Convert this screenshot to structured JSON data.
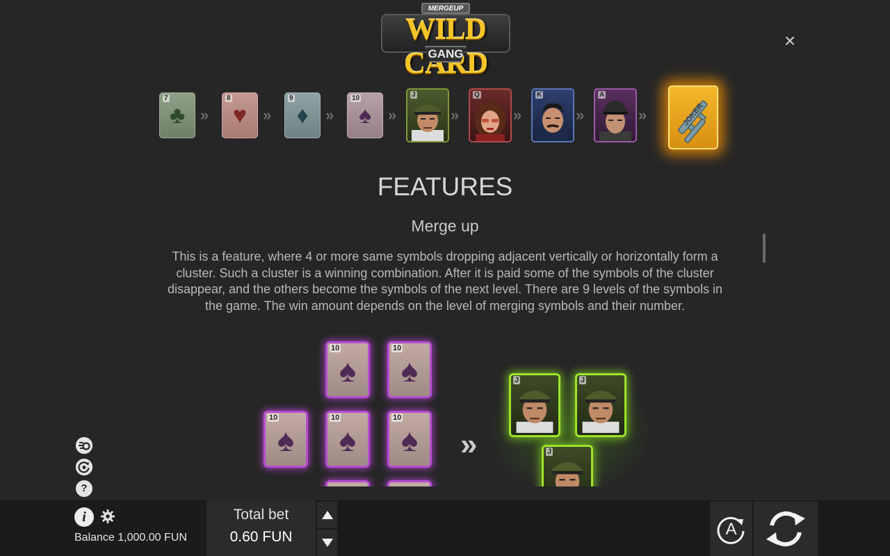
{
  "logo": {
    "brand": "MERGEUP",
    "title": "WILD CARD",
    "subtitle": "GANG"
  },
  "close_icon": "×",
  "levels": [
    {
      "rank": "7",
      "suit": "♣",
      "kind": "club-card"
    },
    {
      "rank": "8",
      "suit": "♥",
      "kind": "heart-card"
    },
    {
      "rank": "9",
      "suit": "♦",
      "kind": "diamond-card"
    },
    {
      "rank": "10",
      "suit": "♠",
      "kind": "spade-card"
    },
    {
      "rank": "J",
      "kind": "jack-portrait"
    },
    {
      "rank": "Q",
      "kind": "queen-portrait"
    },
    {
      "rank": "K",
      "kind": "king-portrait"
    },
    {
      "rank": "A",
      "kind": "ace-portrait"
    },
    {
      "rank": "JOKER",
      "kind": "joker-wild"
    }
  ],
  "level_arrow": "»",
  "features_title": "FEATURES",
  "section_title": "Merge up",
  "description": "This is a feature, where 4 or more same symbols dropping adjacent vertically or horizontally form a cluster. Such a cluster is a winning combination. After it is paid some of the symbols of the cluster disappear, and the others become the symbols of the next level. There are 9 levels of the symbols in the game. The win amount depends on the level of merging symbols and their number.",
  "example": {
    "cluster_rank": "10",
    "cluster_suit": "♠",
    "result_rank": "J",
    "arrow": "»"
  },
  "side_icons": {
    "turbo": "turbo-icon",
    "autoplay_history": "history-icon",
    "help": "?"
  },
  "bottom": {
    "info": "i",
    "balance_label": "Balance",
    "balance_value": "1,000.00 FUN",
    "total_bet_label": "Total bet",
    "total_bet_value": "0.60 FUN",
    "auto_label": "A"
  },
  "colors": {
    "background": "#262626",
    "bottom_bar": "#1b1b1b",
    "cluster_glow": "#b84cd2",
    "result_glow": "#9ee32a",
    "joker_glow": "#ffb300"
  }
}
